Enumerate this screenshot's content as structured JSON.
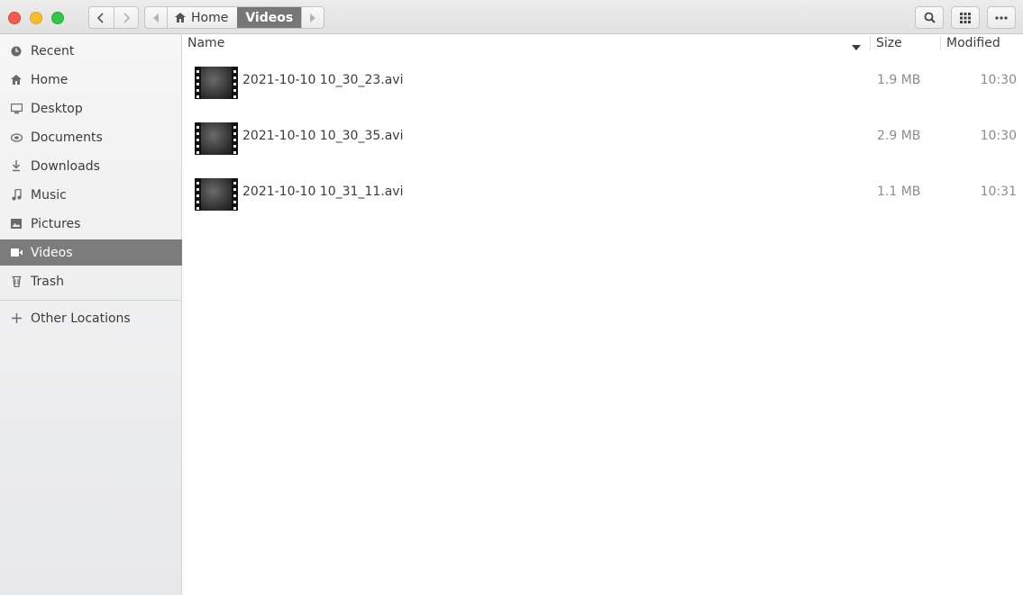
{
  "window": {
    "controls": [
      "close",
      "minimize",
      "maximize"
    ]
  },
  "nav": {
    "back_icon": "chevron-left-icon",
    "forward_icon": "chevron-right-icon"
  },
  "pathbar": {
    "home_label": "Home",
    "current_label": "Videos"
  },
  "header_buttons": {
    "search_icon": "search-icon",
    "view_icon": "grid-icon",
    "menu_icon": "more-icon"
  },
  "sidebar": {
    "items": [
      {
        "label": "Recent",
        "icon": "clock-icon"
      },
      {
        "label": "Home",
        "icon": "home-icon"
      },
      {
        "label": "Desktop",
        "icon": "desktop-icon"
      },
      {
        "label": "Documents",
        "icon": "documents-icon"
      },
      {
        "label": "Downloads",
        "icon": "download-icon"
      },
      {
        "label": "Music",
        "icon": "music-icon"
      },
      {
        "label": "Pictures",
        "icon": "pictures-icon"
      },
      {
        "label": "Videos",
        "icon": "video-icon",
        "selected": true
      },
      {
        "label": "Trash",
        "icon": "trash-icon"
      }
    ],
    "other_locations": {
      "label": "Other Locations",
      "icon": "plus-icon"
    }
  },
  "columns": {
    "name": "Name",
    "size": "Size",
    "modified": "Modified",
    "sort": "descending"
  },
  "files": [
    {
      "name": "2021-10-10 10_30_23.avi",
      "size": "1.9 MB",
      "modified": "10:30"
    },
    {
      "name": "2021-10-10 10_30_35.avi",
      "size": "2.9 MB",
      "modified": "10:30"
    },
    {
      "name": "2021-10-10 10_31_11.avi",
      "size": "1.1 MB",
      "modified": "10:31"
    }
  ],
  "colors": {
    "selected_bg": "#7c7c7c",
    "close": "#f25b4e",
    "minimize": "#f7bd2e",
    "maximize": "#33c748"
  }
}
